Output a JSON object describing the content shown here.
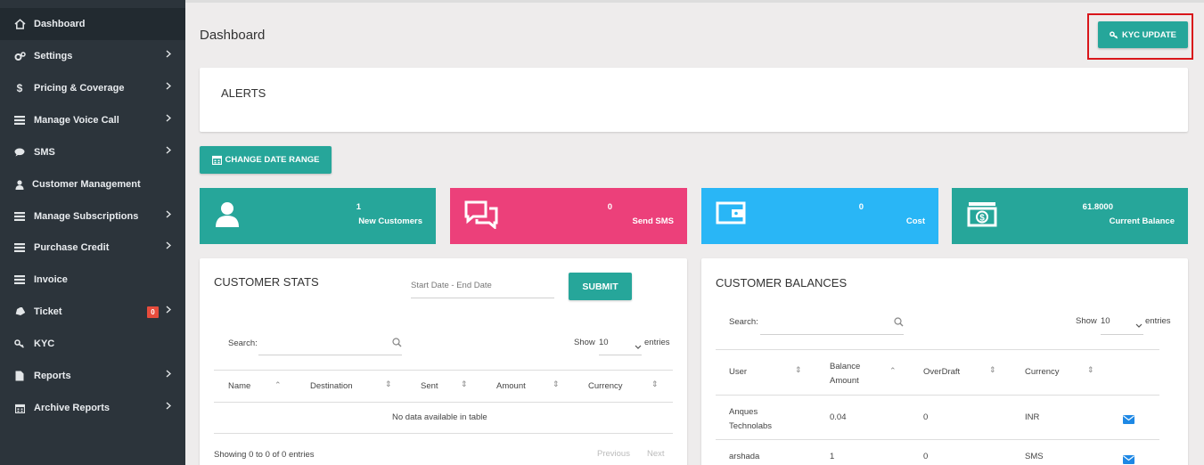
{
  "sidebar": {
    "items": [
      {
        "label": "Dashboard",
        "icon": "home-icon",
        "chevron": false
      },
      {
        "label": "Settings",
        "icon": "gears-icon",
        "chevron": true
      },
      {
        "label": "Pricing & Coverage",
        "icon": "dollar-icon",
        "chevron": true
      },
      {
        "label": "Manage Voice Call",
        "icon": "list-icon",
        "chevron": true
      },
      {
        "label": "SMS",
        "icon": "comment-icon",
        "chevron": true
      },
      {
        "label": "Customer Management",
        "icon": "user-icon",
        "chevron": false
      },
      {
        "label": "Manage Subscriptions",
        "icon": "list-icon",
        "chevron": true
      },
      {
        "label": "Purchase Credit",
        "icon": "list-icon",
        "chevron": true
      },
      {
        "label": "Invoice",
        "icon": "list-icon",
        "chevron": false
      },
      {
        "label": "Ticket",
        "icon": "tag-icon",
        "chevron": true,
        "badge": "0"
      },
      {
        "label": "KYC",
        "icon": "key-icon",
        "chevron": false
      },
      {
        "label": "Reports",
        "icon": "file-icon",
        "chevron": true
      },
      {
        "label": "Archive Reports",
        "icon": "calendar-icon",
        "chevron": true
      }
    ]
  },
  "header": {
    "title": "Dashboard",
    "kyc_button": "KYC UPDATE"
  },
  "alerts": {
    "title": "ALERTS"
  },
  "date_range_button": "CHANGE DATE RANGE",
  "stats": [
    {
      "value": "1",
      "label": "New Customers",
      "color": "#26a69a",
      "icon": "user-icon"
    },
    {
      "value": "0",
      "label": "Send SMS",
      "color": "#ec407a",
      "icon": "chat-icon"
    },
    {
      "value": "0",
      "label": "Cost",
      "color": "#29b6f6",
      "icon": "wallet-icon"
    },
    {
      "value": "61.8000",
      "label": "Current Balance",
      "color": "#26a69a",
      "icon": "money-icon"
    }
  ],
  "customer_stats": {
    "title": "CUSTOMER STATS",
    "date_placeholder": "Start Date - End Date",
    "submit": "SUBMIT",
    "search_label": "Search:",
    "show_label": "Show",
    "show_value": "10",
    "entries_label": "entries",
    "columns": [
      "Name",
      "Destination",
      "Sent",
      "Amount",
      "Currency"
    ],
    "empty": "No data available in table",
    "info": "Showing 0 to 0 of 0 entries",
    "previous": "Previous",
    "next": "Next"
  },
  "customer_balances": {
    "title": "CUSTOMER BALANCES",
    "search_label": "Search:",
    "show_label": "Show",
    "show_value": "10",
    "entries_label": "entries",
    "columns": [
      "User",
      "Balance Amount",
      "OverDraft",
      "Currency"
    ],
    "rows": [
      {
        "user": "Anques Technolabs",
        "balance": "0.04",
        "overdraft": "0",
        "currency": "INR"
      },
      {
        "user": "arshada",
        "balance": "1",
        "overdraft": "0",
        "currency": "SMS"
      }
    ]
  },
  "colors": {
    "accent": "#26a69a",
    "sidebar": "#2c343b",
    "pink": "#ec407a",
    "blue": "#29b6f6",
    "mail": "#1e88e5",
    "highlight": "#d9161b"
  }
}
